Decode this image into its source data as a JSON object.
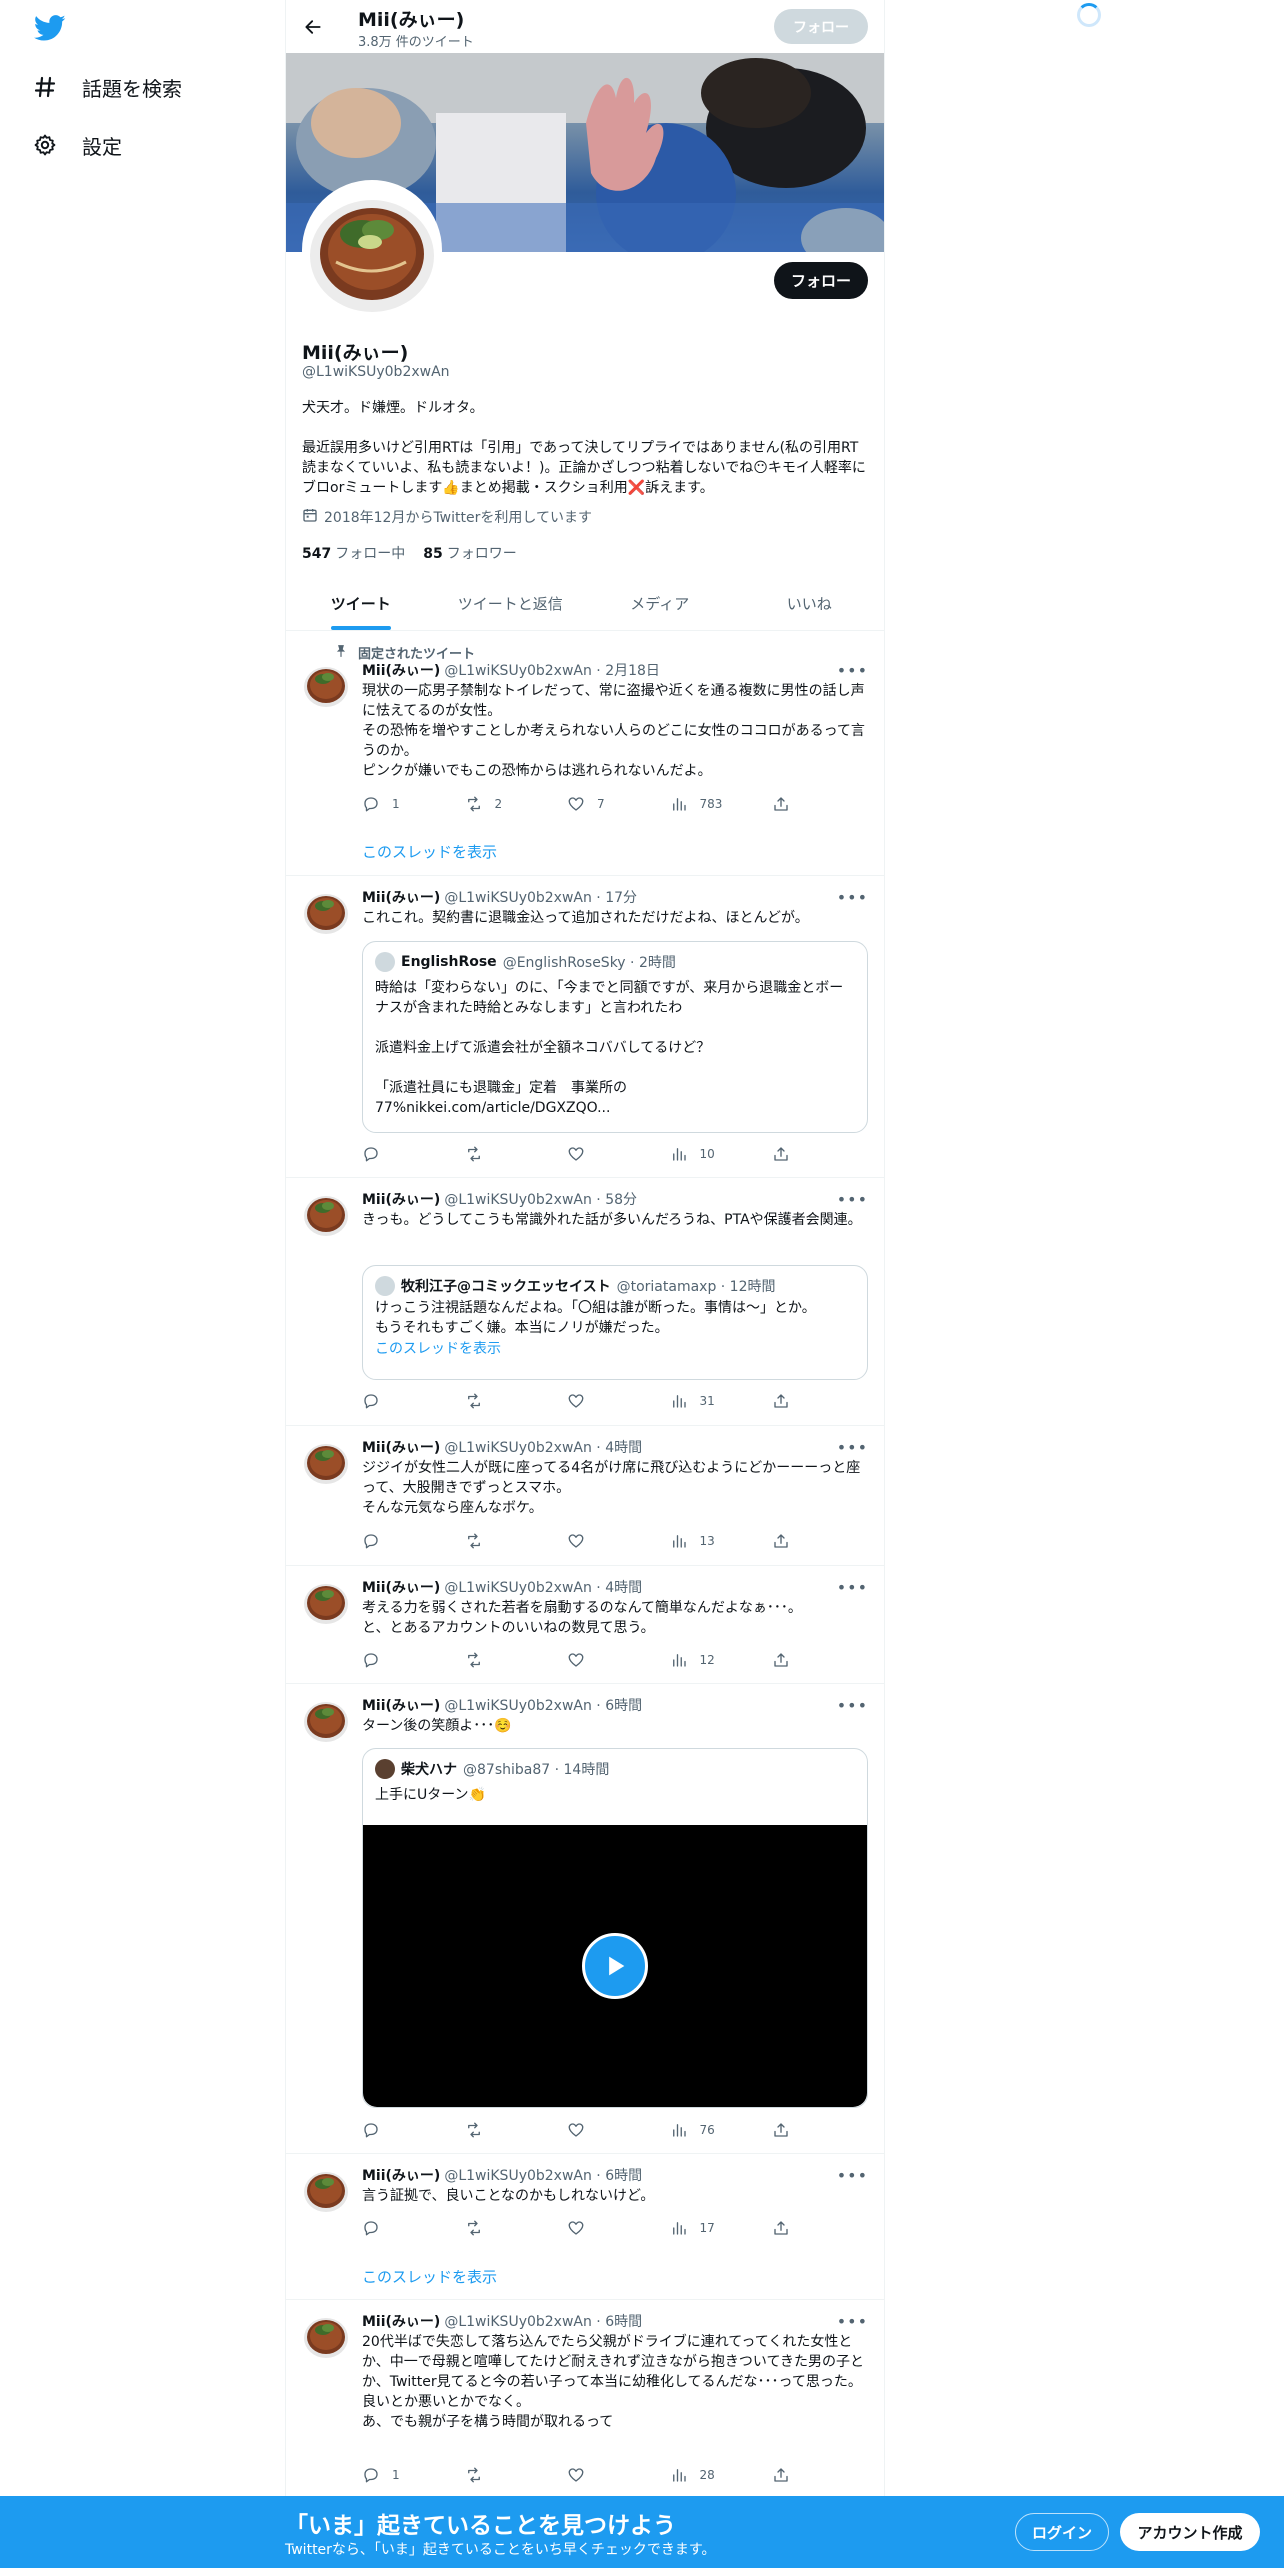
{
  "nav": {
    "explore_label": "話題を検索",
    "settings_label": "設定"
  },
  "header": {
    "name": "Mii(みぃー)",
    "tweet_count": "3.8万 件のツイート",
    "follow_label": "フォロー"
  },
  "profile": {
    "name": "Mii(みぃー)",
    "handle": "@L1wiKSUy0b2xwAn",
    "bio": "犬天才。ド嫌煙。ドルオタ。\n\n最近誤用多いけど引用RTは「引用」であって決してリプライではありません(私の引用RT読まなくていいよ、私も読まないよ！)。正論かざしつつ粘着しないでね😶キモイ人軽率にブロorミュートします👍まとめ掲載・スクショ利用❌訴えます。",
    "joined": "2018年12月からTwitterを利用しています",
    "following_count": "547",
    "following_label": "フォロー中",
    "followers_count": "85",
    "followers_label": "フォロワー",
    "follow_label": "フォロー"
  },
  "tabs": [
    "ツイート",
    "ツイートと返信",
    "メディア",
    "いいね"
  ],
  "pinned_label": "固定されたツイート",
  "thread_link": "このスレッドを表示",
  "tweets": [
    {
      "name": "Mii(みぃー)",
      "meta": "@L1wiKSUy0b2xwAn · 2月18日",
      "text": "現状の一応男子禁制なトイレだって、常に盗撮や近くを通る複数に男性の話し声に怯えてるのが女性。\nその恐怖を増やすことしか考えられない人らのどこに女性のココロがあるって言うのか。\nピンクが嫌いでもこの恐怖からは逃れられないんだよ。",
      "reply": "1",
      "retweet": "2",
      "like": "7",
      "views": "783"
    },
    {
      "name": "Mii(みぃー)",
      "meta": "@L1wiKSUy0b2xwAn · 17分",
      "text": "これこれ。契約書に退職金込って追加されただけだよね、ほとんどが。",
      "quote": {
        "name": "EnglishRose",
        "meta": "@EnglishRoseSky · 2時間",
        "text": "時給は「変わらない」のに、「今までと同額ですが、来月から退職金とボーナスが含まれた時給とみなします」と言われたわ\n\n派遣料金上げて派遣会社が全額ネコババしてるけど？\n\n「派遣社員にも退職金」定着　事業所の\n77%nikkei.com/article/DGXZQO..."
      },
      "reply": "",
      "retweet": "",
      "like": "",
      "views": "10"
    },
    {
      "name": "Mii(みぃー)",
      "meta": "@L1wiKSUy0b2xwAn · 58分",
      "text": "きっも。どうしてこうも常識外れた話が多いんだろうね、PTAや保護者会関連。",
      "quote": {
        "name": "牧利江子@コミックエッセイスト",
        "meta": "@toriatamaxp · 12時間",
        "text": "けっこう注視話題なんだよね。「〇組は誰が断った。事情は〜」とか。\nもうそれもすごく嫌。本当にノリが嫌だった。",
        "link": "このスレッドを表示"
      },
      "reply": "",
      "retweet": "",
      "like": "",
      "views": "31"
    },
    {
      "name": "Mii(みぃー)",
      "meta": "@L1wiKSUy0b2xwAn · 4時間",
      "text": "ジジイが女性二人が既に座ってる4名がけ席に飛び込むようにどかーーーっと座って、大股開きでずっとスマホ。\nそんな元気なら座んなボケ。",
      "reply": "",
      "retweet": "",
      "like": "",
      "views": "13"
    },
    {
      "name": "Mii(みぃー)",
      "meta": "@L1wiKSUy0b2xwAn · 4時間",
      "text": "考える力を弱くされた若者を扇動するのなんて簡単なんだよなぁ･･･。\nと、とあるアカウントのいいねの数見て思う。",
      "reply": "",
      "retweet": "",
      "like": "",
      "views": "12"
    },
    {
      "name": "Mii(みぃー)",
      "meta": "@L1wiKSUy0b2xwAn · 6時間",
      "text": "ターン後の笑顔よ･･･☺️",
      "quote": {
        "name": "柴犬ハナ",
        "meta": "@87shiba87 · 14時間",
        "text": "上手にUターン👏"
      },
      "reply": "",
      "retweet": "",
      "like": "",
      "views": "76"
    },
    {
      "name": "Mii(みぃー)",
      "meta": "@L1wiKSUy0b2xwAn · 6時間",
      "text": "言う証拠で、良いことなのかもしれないけど。",
      "reply": "",
      "retweet": "",
      "like": "",
      "views": "17"
    },
    {
      "name": "Mii(みぃー)",
      "meta": "@L1wiKSUy0b2xwAn · 6時間",
      "text": "20代半ばで失恋して落ち込んでたら父親がドライブに連れてってくれた女性とか、中一で母親と喧嘩してたけど耐えきれず泣きながら抱きついてきた男の子とか、Twitter見てると今の若い子って本当に幼稚化してるんだな･･･って思った。\n良いとか悪いとかでなく。\nあ、でも親が子を構う時間が取れるって",
      "reply": "1",
      "retweet": "",
      "like": "",
      "views": "28"
    }
  ],
  "bottom": {
    "title": "「いま」起きていることを見つけよう",
    "subtitle": "Twitterなら、「いま」起きていることをいち早くチェックできます。",
    "login_label": "ログイン",
    "signup_label": "アカウント作成"
  },
  "colors": {
    "accent": "#1d9bf0",
    "text": "#0f1419",
    "muted": "#536471"
  }
}
